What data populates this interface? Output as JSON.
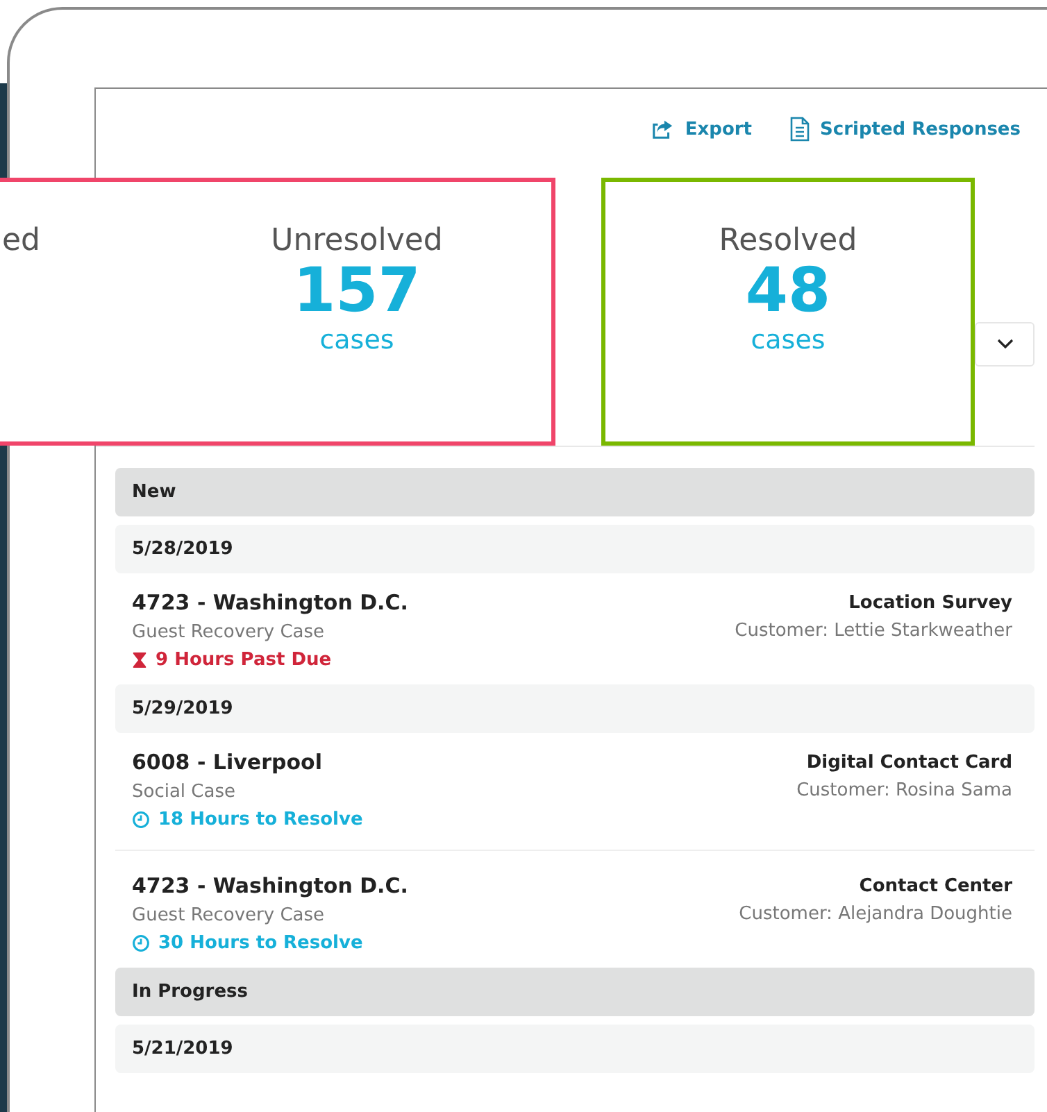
{
  "toolbar": {
    "actions": [
      {
        "label": "Export",
        "kind": "export"
      },
      {
        "label": "Scripted Responses",
        "kind": "document"
      }
    ]
  },
  "summary": {
    "cards": [
      {
        "color": "#f0456a",
        "stats": [
          {
            "label": "ed"
          },
          {
            "label": "Unresolved",
            "count": "157",
            "unit": "cases"
          }
        ]
      },
      {
        "color": "#7ab800",
        "stats": [
          {
            "label": "Resolved",
            "count": "48",
            "unit": "cases"
          }
        ]
      }
    ]
  },
  "groups": [
    {
      "title": "New",
      "dates": [
        {
          "date": "5/28/2019",
          "cases": [
            {
              "title": "4723 - Washington D.C.",
              "type": "Guest Recovery Case",
              "status": {
                "kind": "overdue",
                "text": "9 Hours Past Due"
              },
              "channel": "Location Survey",
              "customer": "Customer: Lettie Starkweather"
            }
          ]
        },
        {
          "date": "5/29/2019",
          "cases": [
            {
              "title": "6008 - Liverpool",
              "type": "Social Case",
              "status": {
                "kind": "pending",
                "text": "18 Hours to Resolve"
              },
              "channel": "Digital Contact Card",
              "customer": "Customer: Rosina Sama"
            },
            {
              "title": "4723 - Washington D.C.",
              "type": "Guest Recovery Case",
              "status": {
                "kind": "pending",
                "text": "30 Hours to Resolve"
              },
              "channel": "Contact Center",
              "customer": "Customer: Alejandra Doughtie"
            }
          ]
        }
      ]
    },
    {
      "title": "In Progress",
      "dates": [
        {
          "date": "5/21/2019"
        }
      ]
    }
  ]
}
